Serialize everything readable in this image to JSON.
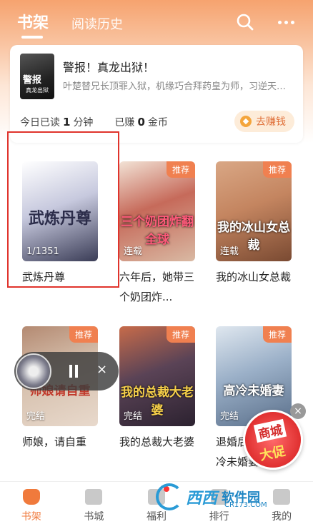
{
  "header": {
    "tabs": [
      {
        "label": "书架",
        "active": true
      },
      {
        "label": "阅读历史",
        "active": false
      }
    ],
    "search_icon": "search-icon",
    "more_icon": "more-icon"
  },
  "recent": {
    "cover_text": "警报",
    "cover_sub": "真龙出狱",
    "title": "警报！真龙出狱！",
    "desc": "叶楚替兄长顶罪入狱，机缘巧合拜药皇为师，习逆天医术",
    "stats_prefix": "今日已读",
    "minutes": "1",
    "minutes_unit": "分钟",
    "earned_prefix": "已赚",
    "coins": "0",
    "coins_unit": "金币",
    "earn_button": "去赚钱",
    "accent": "#e0713a"
  },
  "books": [
    {
      "name": "武炼丹尊",
      "cover_title": "武炼丹尊",
      "badge": "",
      "overlay": "1/1351",
      "colors": [
        "#3a3c56",
        "#c7c9de",
        "#ffffff"
      ]
    },
    {
      "name": "六年后，她带三个奶团炸...",
      "cover_title": "三个奶团炸翻全球",
      "badge": "推荐",
      "overlay": "连载",
      "colors": [
        "#d9b9a3",
        "#c66a5a",
        "#f2e2d5"
      ]
    },
    {
      "name": "我的冰山女总裁",
      "cover_title": "我的冰山女总裁",
      "badge": "推荐",
      "overlay": "连载",
      "colors": [
        "#7a4a32",
        "#c48560",
        "#d9a785"
      ]
    },
    {
      "name": "师娘，请自重",
      "cover_title": "师娘请自重",
      "badge": "推荐",
      "overlay": "完结",
      "colors": [
        "#e8d9cc",
        "#d6c0ad",
        "#b48a72"
      ]
    },
    {
      "name": "我的总裁大老婆",
      "cover_title": "我的总裁大老婆",
      "badge": "推荐",
      "overlay": "完结",
      "colors": [
        "#2c2230",
        "#5a4356",
        "#c76b4a"
      ]
    },
    {
      "name": "退婚后，我的高冷未婚妻",
      "cover_title": "高冷未婚妻",
      "badge": "推荐",
      "overlay": "完结",
      "colors": [
        "#5a6f8a",
        "#9bb0c8",
        "#dfe7ef"
      ]
    }
  ],
  "mini_player": {
    "pause_icon": "pause-icon",
    "close_symbol": "×"
  },
  "promo": {
    "line1": "商城",
    "line2": "大促",
    "close_symbol": "×"
  },
  "bottom_nav": [
    {
      "label": "书架",
      "active": true
    },
    {
      "label": "书城",
      "active": false
    },
    {
      "label": "福利",
      "active": false
    },
    {
      "label": "排行",
      "active": false
    },
    {
      "label": "我的",
      "active": false
    }
  ],
  "watermark": {
    "brand": "西西",
    "text": "软件园",
    "url": "CR173.COM"
  }
}
